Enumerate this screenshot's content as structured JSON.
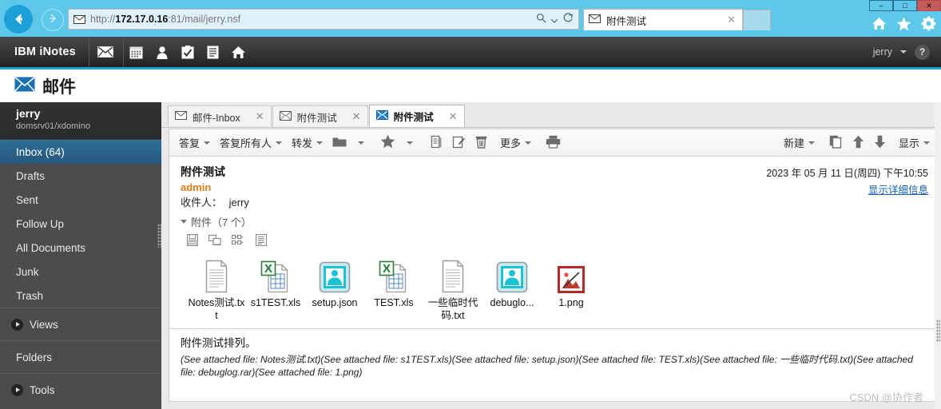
{
  "browser": {
    "url_plain_prefix": "http://",
    "url_host": "172.17.0.16",
    "url_suffix": ":81/mail/jerry.nsf",
    "back_icon": "back-arrow-icon",
    "forward_icon": "forward-arrow-icon",
    "search_icon": "search-icon",
    "refresh_icon": "refresh-icon",
    "home_icon": "home-icon",
    "favorites_icon": "star-icon",
    "settings_icon": "gear-icon",
    "minimize_label": "–",
    "maximize_label": "□",
    "close_label": "✕",
    "tabs": [
      {
        "label": "附件测试",
        "close": "✕"
      }
    ]
  },
  "banner": {
    "brand": "IBM iNotes",
    "icons": [
      "mail-icon",
      "calendar-icon",
      "contacts-icon",
      "tasks-icon",
      "notebook-icon",
      "home-icon"
    ],
    "user": "jerry",
    "help_label": "?"
  },
  "page_title": "邮件",
  "sidebar": {
    "user_name": "jerry",
    "user_server": "domsrv01/xdomino",
    "items": [
      {
        "label": "Inbox (64)",
        "selected": true
      },
      {
        "label": "Drafts",
        "selected": false
      },
      {
        "label": "Sent",
        "selected": false
      },
      {
        "label": "Follow Up",
        "selected": false
      },
      {
        "label": "All Documents",
        "selected": false
      },
      {
        "label": "Junk",
        "selected": false
      },
      {
        "label": "Trash",
        "selected": false
      }
    ],
    "groups": [
      {
        "label": "Views",
        "arrow": true
      },
      {
        "label": "Folders",
        "arrow": false
      },
      {
        "label": "Tools",
        "arrow": true
      }
    ]
  },
  "content_tabs": [
    {
      "label": "邮件-Inbox",
      "icon": "mail-icon",
      "active": false,
      "close": "✕"
    },
    {
      "label": "附件测试",
      "icon": "mail-open-icon",
      "active": false,
      "close": "✕"
    },
    {
      "label": "附件测试",
      "icon": "mail-open-icon",
      "active": true,
      "close": "✕"
    }
  ],
  "toolbar_left": [
    {
      "label": "答复",
      "caret": true,
      "icon": null
    },
    {
      "label": "答复所有人",
      "caret": true,
      "icon": null
    },
    {
      "label": "转发",
      "caret": true,
      "icon": null
    },
    {
      "label": "",
      "caret": true,
      "icon": "folder-icon"
    },
    {
      "label": "",
      "caret": true,
      "icon": "star-icon"
    },
    {
      "label": "",
      "caret": false,
      "icon": "copy-into-icon"
    },
    {
      "label": "",
      "caret": false,
      "icon": "edit-icon"
    },
    {
      "label": "",
      "caret": false,
      "icon": "trash-icon"
    },
    {
      "label": "更多",
      "caret": true,
      "icon": null
    },
    {
      "label": "",
      "caret": false,
      "icon": "print-icon"
    }
  ],
  "toolbar_right": [
    {
      "label": "新建",
      "caret": true,
      "icon": null
    },
    {
      "label": "",
      "caret": false,
      "icon": "copy-icon"
    },
    {
      "label": "",
      "caret": false,
      "icon": "arrow-up-icon"
    },
    {
      "label": "",
      "caret": false,
      "icon": "arrow-down-icon"
    },
    {
      "label": "显示",
      "caret": true,
      "icon": null
    }
  ],
  "message": {
    "subject": "附件测试",
    "sender": "admin",
    "recipient_label": "收件人：",
    "recipient": "jerry",
    "datetime": "2023 年 05 月 11 日(周四) 下午10:55",
    "show_details": "显示详细信息",
    "attachments_label": "附件（7 个）",
    "attachment_tool_icons": [
      "save-icon",
      "view-icon",
      "thumbnails-icon",
      "details-icon"
    ],
    "attachments": [
      {
        "name": "Notes测试.txt",
        "type": "txt"
      },
      {
        "name": "s1TEST.xls",
        "type": "xls"
      },
      {
        "name": "setup.json",
        "type": "json"
      },
      {
        "name": "TEST.xls",
        "type": "xls"
      },
      {
        "name": "一些临时代码.txt",
        "type": "txt"
      },
      {
        "name": "debuglo...",
        "type": "json"
      },
      {
        "name": "1.png",
        "type": "png"
      }
    ],
    "body_line1": "附件测试排列。",
    "body_line2": "(See attached file: Notes测试.txt)(See attached file: s1TEST.xls)(See attached file: setup.json)(See attached file: TEST.xls)(See attached file: 一些临时代码.txt)(See attached file: debuglog.rar)(See attached file: 1.png)"
  },
  "watermark": "CSDN @协作者",
  "colors": {
    "ie_chrome": "#5ec8ea",
    "inotes_accent": "#1ba3d8",
    "sidebar_bg": "#4c4c4c",
    "sidebar_selected": "#2f6f99",
    "sender_orange": "#e07b18",
    "link_blue": "#1560b0"
  }
}
